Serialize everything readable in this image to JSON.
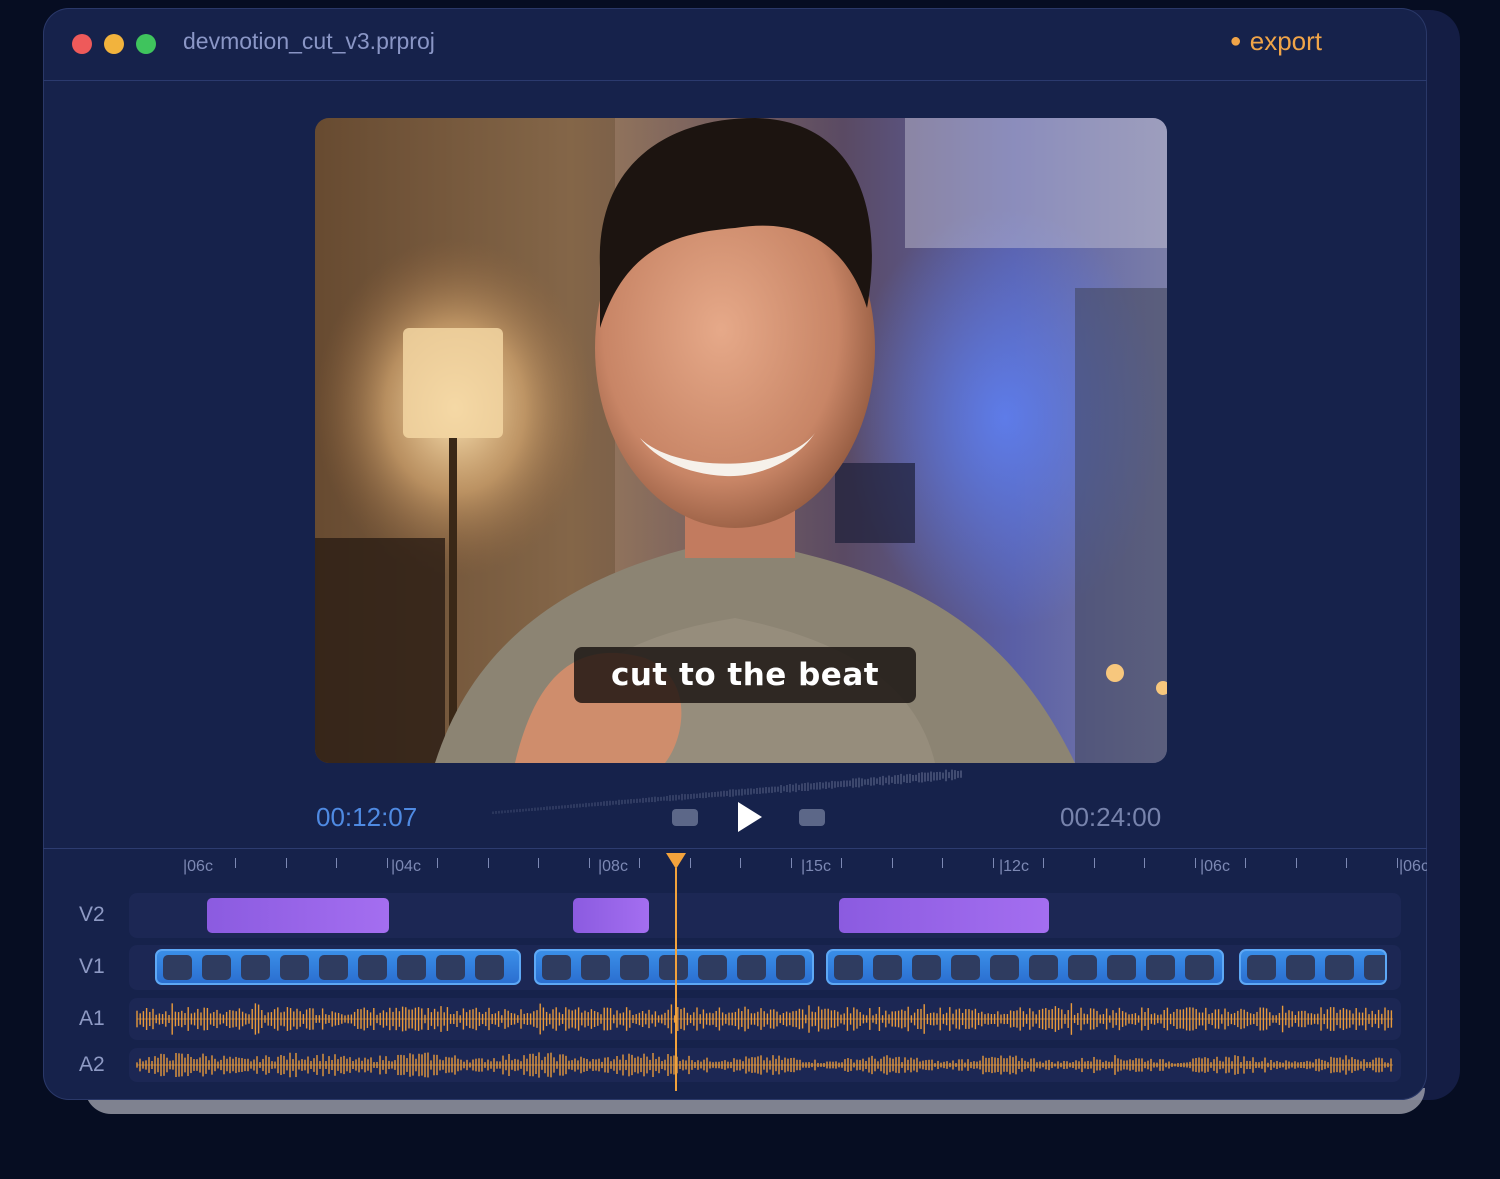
{
  "window": {
    "title": "devmotion_cut_v3.prproj",
    "export_label": "export",
    "controls": [
      "close",
      "minimize",
      "maximize"
    ]
  },
  "viewer": {
    "caption": "cut to the beat"
  },
  "transport": {
    "current_time": "00:12:07",
    "total_time": "00:24:00",
    "icons": [
      "prev-marker-icon",
      "play-icon",
      "next-marker-icon"
    ]
  },
  "ruler": {
    "labels": [
      "|06c",
      "|04c",
      "|08c",
      "|15c",
      "|12c",
      "|06c",
      "|06c"
    ]
  },
  "tracks": {
    "v2": "V2",
    "v1": "V1",
    "a1": "A1",
    "a2": "A2"
  },
  "colors": {
    "accent": "#f0a448",
    "video_clip": "#3a8fe8",
    "overlay_clip": "#9c68ec",
    "audio_wave": "#e89a3c",
    "background": "#16224b"
  }
}
